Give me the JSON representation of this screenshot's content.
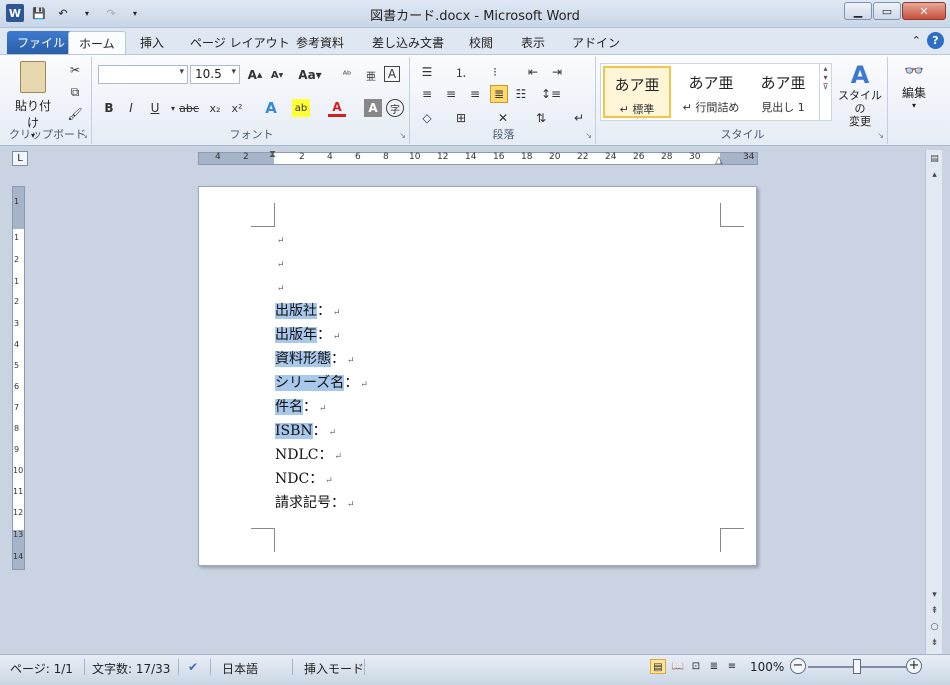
{
  "window": {
    "title": "図書カード.docx - Microsoft Word",
    "app_icon": "W",
    "min_label": "▁",
    "max_label": "▭",
    "close_label": "✕"
  },
  "tabs": [
    "ファイル",
    "ホーム",
    "挿入",
    "ページ レイアウト",
    "参考資料",
    "差し込み文書",
    "校閲",
    "表示",
    "アドイン"
  ],
  "ribbon": {
    "clipboard": {
      "label": "クリップボード",
      "paste": "貼り付け"
    },
    "font": {
      "label": "フォント",
      "font_name": "",
      "font_size": "10.5"
    },
    "paragraph": {
      "label": "段落"
    },
    "styles": {
      "label": "スタイル",
      "items": [
        {
          "sample": "あア亜",
          "name": "↵ 標準"
        },
        {
          "sample": "あア亜",
          "name": "↵ 行間詰め"
        },
        {
          "sample": "あア亜",
          "name": "見出し 1"
        }
      ],
      "change_label": "スタイルの\n変更"
    },
    "editing": {
      "label": "編集"
    }
  },
  "ruler": {
    "h_numbers": [
      "4",
      "2",
      "2",
      "4",
      "6",
      "8",
      "10",
      "12",
      "14",
      "16",
      "18",
      "20",
      "22",
      "24",
      "26",
      "28",
      "30",
      "34"
    ],
    "v_numbers": [
      "1",
      "1",
      "2",
      "1",
      "2",
      "3",
      "4",
      "5",
      "6",
      "7",
      "8",
      "9",
      "10",
      "11",
      "12",
      "13",
      "14"
    ]
  },
  "document": {
    "lines": [
      {
        "text": "",
        "highlight": false
      },
      {
        "text": "",
        "highlight": false
      },
      {
        "text": "",
        "highlight": false
      },
      {
        "text": "出版社",
        "suffix": "：",
        "highlight": true
      },
      {
        "text": "出版年",
        "suffix": "：",
        "highlight": true
      },
      {
        "text": "資料形態",
        "suffix": "：",
        "highlight": true
      },
      {
        "text": "シリーズ名",
        "suffix": "：",
        "highlight": true
      },
      {
        "text": "件名",
        "suffix": "：",
        "highlight": true
      },
      {
        "text": "ISBN",
        "suffix": "：",
        "highlight": true
      },
      {
        "text": "NDLC",
        "suffix": "：",
        "highlight": false
      },
      {
        "text": "NDC",
        "suffix": "：",
        "highlight": false
      },
      {
        "text": "請求記号",
        "suffix": "：",
        "highlight": false
      }
    ],
    "para_mark": "↵"
  },
  "status": {
    "page": "ページ: 1/1",
    "words": "文字数: 17/33",
    "language": "日本語",
    "mode": "挿入モード",
    "zoom": "100%"
  },
  "colors": {
    "selection": "#a8c8ec",
    "file_tab": "#2a5ea8"
  }
}
